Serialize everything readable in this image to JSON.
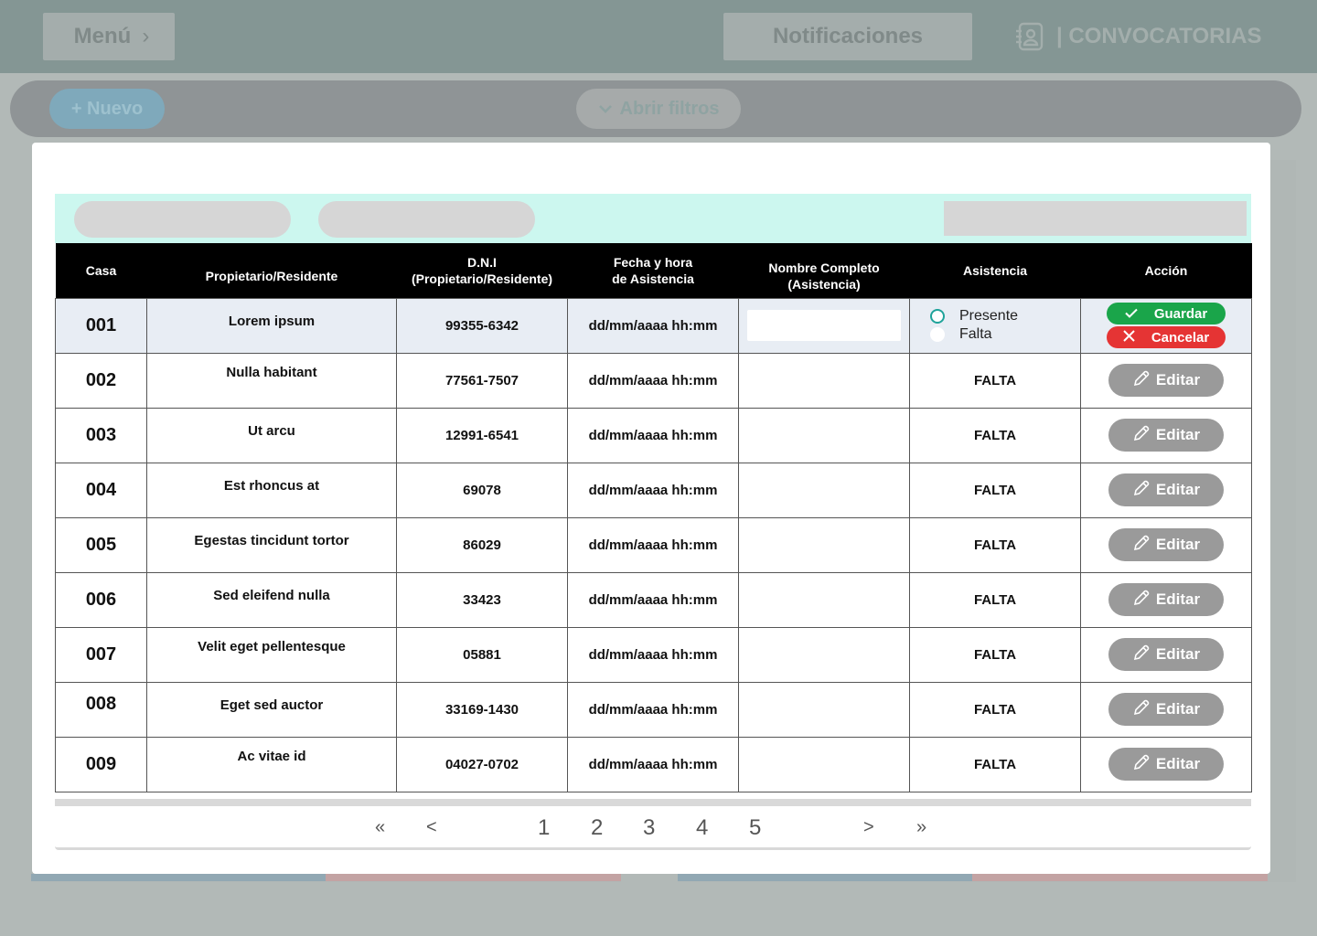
{
  "header": {
    "menu_label": "Menú",
    "notifications_label": "Notificaciones",
    "brand_label": "| CONVOCATORIAS"
  },
  "toolbar": {
    "new_label": "+ Nuevo",
    "filters_label": "Abrir filtros"
  },
  "table": {
    "columns": [
      "Casa",
      "Propietario/Residente",
      "D.N.I\n(Propietario/Residente)",
      "Fecha y hora\nde Asistencia",
      "Nombre Completo\n(Asistencia)",
      "Asistencia",
      "Acción"
    ],
    "rows": [
      {
        "casa": "001",
        "owner": "Lorem ipsum",
        "dni": "99355-6342",
        "datetime": "dd/mm/aaaa hh:mm",
        "name": "",
        "status": "",
        "editing": true
      },
      {
        "casa": "002",
        "owner": "Nulla habitant",
        "dni": "77561-7507",
        "datetime": "dd/mm/aaaa hh:mm",
        "name": "",
        "status": "FALTA"
      },
      {
        "casa": "003",
        "owner": "Ut arcu",
        "dni": "12991-6541",
        "datetime": "dd/mm/aaaa hh:mm",
        "name": "",
        "status": "FALTA"
      },
      {
        "casa": "004",
        "owner": "Est rhoncus at",
        "dni": "69078",
        "datetime": "dd/mm/aaaa hh:mm",
        "name": "",
        "status": "FALTA"
      },
      {
        "casa": "005",
        "owner": "Egestas tincidunt tortor",
        "dni": "86029",
        "datetime": "dd/mm/aaaa hh:mm",
        "name": "",
        "status": "FALTA"
      },
      {
        "casa": "006",
        "owner": "Sed eleifend nulla",
        "dni": "33423",
        "datetime": "dd/mm/aaaa hh:mm",
        "name": "",
        "status": "FALTA"
      },
      {
        "casa": "007",
        "owner": "Velit eget pellentesque",
        "dni": "05881",
        "datetime": "dd/mm/aaaa hh:mm",
        "name": "",
        "status": "FALTA"
      },
      {
        "casa": "008",
        "owner": "Eget sed auctor",
        "dni": "33169-1430",
        "datetime": "dd/mm/aaaa hh:mm",
        "name": "",
        "status": "FALTA"
      },
      {
        "casa": "009",
        "owner": "Ac vitae id",
        "dni": "04027-0702",
        "datetime": "dd/mm/aaaa hh:mm",
        "name": "",
        "status": "FALTA"
      }
    ],
    "attendance_options": [
      "Presente",
      "Falta"
    ],
    "save_label": "Guardar",
    "cancel_label": "Cancelar",
    "edit_label": "Editar"
  },
  "pagination": {
    "first": "«",
    "prev": "<",
    "pages": [
      "1",
      "2",
      "3",
      "4",
      "5"
    ],
    "next": ">",
    "last": "»"
  },
  "colors": {
    "status_falta": "#e23b3b",
    "save": "#1aa54a",
    "cancel": "#e53434",
    "filter_bar": "#ccf7ef"
  }
}
